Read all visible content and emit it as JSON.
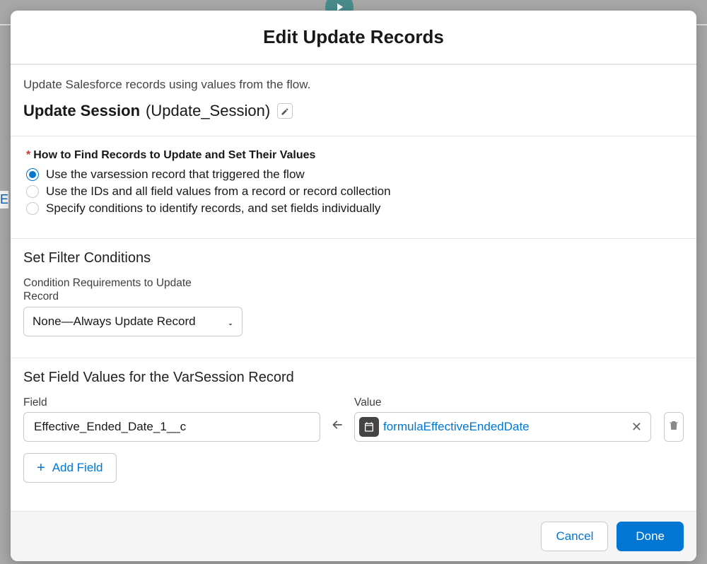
{
  "modal": {
    "title": "Edit Update Records",
    "description": "Update Salesforce records using values from the flow.",
    "record_label": "Update Session",
    "record_api": "(Update_Session)"
  },
  "findRecords": {
    "label": "How to Find Records to Update and Set Their Values",
    "options": [
      "Use the varsession record that triggered the flow",
      "Use the IDs and all field values from a record or record collection",
      "Specify conditions to identify records, and set fields individually"
    ],
    "selected_index": 0
  },
  "filter": {
    "heading": "Set Filter Conditions",
    "requirements_label": "Condition Requirements to Update Record",
    "requirements_value": "None—Always Update Record"
  },
  "fieldValues": {
    "heading": "Set Field Values for the VarSession Record",
    "field_label": "Field",
    "value_label": "Value",
    "rows": [
      {
        "field": "Effective_Ended_Date_1__c",
        "value": "formulaEffectiveEndedDate",
        "value_icon": "date-icon"
      }
    ],
    "add_label": "Add Field"
  },
  "footer": {
    "cancel": "Cancel",
    "done": "Done"
  },
  "background_text": "E"
}
